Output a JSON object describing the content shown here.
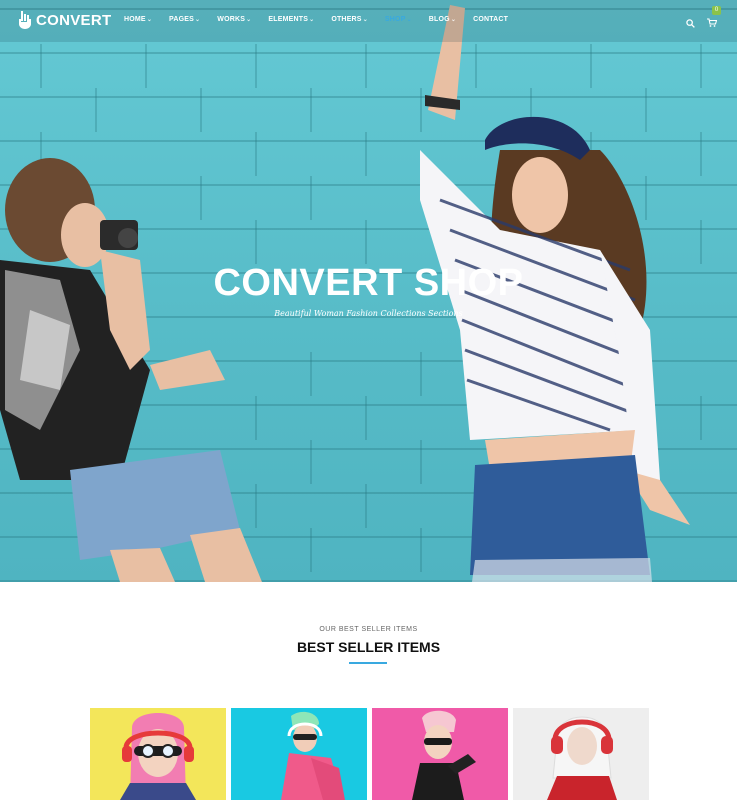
{
  "brand": {
    "name": "CONVERT"
  },
  "nav": {
    "items": [
      {
        "label": "HOME",
        "has_dropdown": true,
        "active": false
      },
      {
        "label": "PAGES",
        "has_dropdown": true,
        "active": false
      },
      {
        "label": "WORKS",
        "has_dropdown": true,
        "active": false
      },
      {
        "label": "ELEMENTS",
        "has_dropdown": true,
        "active": false
      },
      {
        "label": "OTHERS",
        "has_dropdown": true,
        "active": false
      },
      {
        "label": "SHOP",
        "has_dropdown": true,
        "active": true
      },
      {
        "label": "BLOG",
        "has_dropdown": true,
        "active": false
      },
      {
        "label": "CONTACT",
        "has_dropdown": false,
        "active": false
      }
    ],
    "cart_count": "0",
    "icons": [
      "search-icon",
      "cart-icon"
    ]
  },
  "hero": {
    "title": "CONVERT SHOP",
    "subtitle": "Beautiful Woman Fashion Collections Sections"
  },
  "best_sellers": {
    "kicker": "OUR BEST SELLER ITEMS",
    "title": "BEST SELLER ITEMS",
    "products": [
      {
        "bg": "#f3e65a"
      },
      {
        "bg": "#19c9e2"
      },
      {
        "bg": "#f05aa8"
      },
      {
        "bg": "#eeeeee"
      }
    ]
  },
  "colors": {
    "accent": "#39a9e0",
    "hero_wall": "#5cc3cf",
    "badge": "#8bc34a"
  }
}
